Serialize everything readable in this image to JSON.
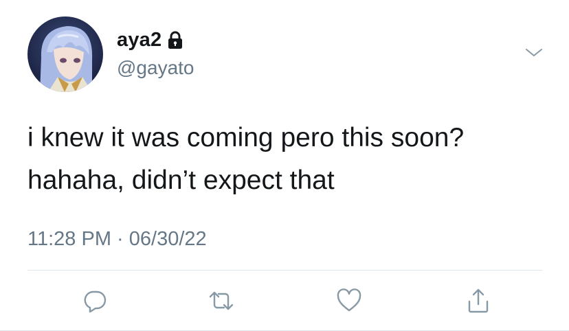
{
  "tweet": {
    "author": {
      "display_name": "aya2",
      "handle": "@gayato",
      "protected_icon": "lock-icon",
      "avatar_icon": "anime-character-avatar"
    },
    "menu_icon": "chevron-down-icon",
    "text_lines": [
      "i knew it was coming pero this soon?",
      "hahaha, didn’t expect that"
    ],
    "meta": {
      "time": "11:28 PM",
      "separator": " · ",
      "date": "06/30/22"
    },
    "actions": [
      {
        "name": "reply",
        "icon": "reply-bubble-icon"
      },
      {
        "name": "retweet",
        "icon": "retweet-icon"
      },
      {
        "name": "like",
        "icon": "heart-icon"
      },
      {
        "name": "share",
        "icon": "share-icon"
      }
    ],
    "colors": {
      "text": "#14171a",
      "secondary": "#657786",
      "icon": "#8899a6",
      "divider": "#e1e8ed"
    }
  }
}
